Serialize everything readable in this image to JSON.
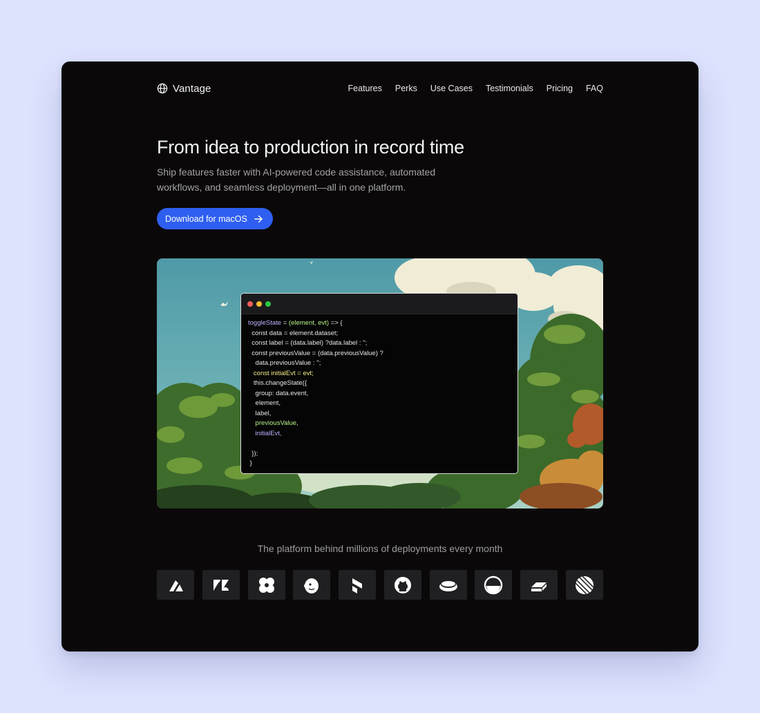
{
  "brand": {
    "name": "Vantage",
    "icon": "globe-icon"
  },
  "nav": {
    "links": [
      "Features",
      "Perks",
      "Use Cases",
      "Testimonials",
      "Pricing",
      "FAQ"
    ]
  },
  "hero": {
    "headline": "From idea to production in record time",
    "subtitle": "Ship features faster with AI-powered code assistance, automated workflows, and seamless deployment—all in one platform.",
    "cta_label": "Download for macOS",
    "cta_icon": "arrow-right-icon",
    "accent_color": "#2f5ff0"
  },
  "code_window": {
    "lines": [
      [
        {
          "t": "toggleState",
          "c": "#b9b2ff"
        },
        {
          "t": " = ",
          "c": "#e6e6e6"
        },
        {
          "t": "(element, evt)",
          "c": "#b9f28a"
        },
        {
          "t": " => {",
          "c": "#e6e6e6"
        }
      ],
      [
        {
          "t": "  const data = element.dataset;",
          "c": "#e6e6e6"
        }
      ],
      [
        {
          "t": "  const label = (data.label) ?data.label : '';",
          "c": "#e6e6e6"
        }
      ],
      [
        {
          "t": "  const previousValue = (data.previousValue) ?",
          "c": "#e6e6e6"
        }
      ],
      [
        {
          "t": "    data.previousValue : '';",
          "c": "#e6e6e6"
        }
      ],
      [
        {
          "t": "   const initialEvt = evt;",
          "c": "#f3ec8a"
        }
      ],
      [
        {
          "t": "   this.changeState({",
          "c": "#e6e6e6"
        }
      ],
      [
        {
          "t": "    group: data.event,",
          "c": "#e6e6e6"
        }
      ],
      [
        {
          "t": "    element,",
          "c": "#e6e6e6"
        }
      ],
      [
        {
          "t": "    label,",
          "c": "#e6e6e6"
        }
      ],
      [
        {
          "t": "    previousValue,",
          "c": "#b9f28a"
        }
      ],
      [
        {
          "t": "    initialEvt,",
          "c": "#b9b2ff"
        }
      ],
      [
        {
          "t": "",
          "c": "#e6e6e6"
        }
      ],
      [
        {
          "t": "  });",
          "c": "#e6e6e6"
        }
      ],
      [
        {
          "t": " }",
          "c": "#e6e6e6"
        }
      ]
    ]
  },
  "logos": {
    "tagline": "The platform behind millions of deployments every month",
    "items": [
      "abstract-triangle-logo-icon",
      "zendesk-logo-icon",
      "four-petal-logo-icon",
      "mailchimp-logo-icon",
      "cube-stack-logo-icon",
      "github-logo-icon",
      "disc-logo-icon",
      "half-circle-logo-icon",
      "stacked-slabs-logo-icon",
      "striped-circle-logo-icon"
    ]
  }
}
